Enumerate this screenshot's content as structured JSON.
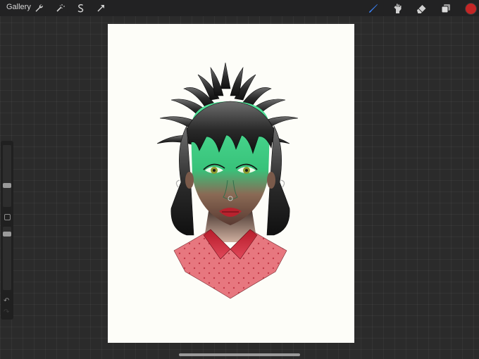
{
  "toolbar": {
    "gallery_label": "Gallery",
    "left_icons": [
      "wrench-icon",
      "magic-wand-icon",
      "selection-icon",
      "transform-arrow-icon"
    ],
    "right_icons": [
      "brush-icon",
      "smudge-icon",
      "eraser-icon",
      "layers-icon"
    ],
    "active_tool": "brush",
    "accent_color": "#3b82f6",
    "current_color": "#c42525"
  },
  "sidebar": {
    "brush_size_level": 0.33,
    "opacity_level": 0.66,
    "undo_glyph": "↶",
    "redo_glyph": "↷"
  },
  "canvas": {
    "background": "#fdfdf8",
    "artwork": "portrait-illustration"
  }
}
